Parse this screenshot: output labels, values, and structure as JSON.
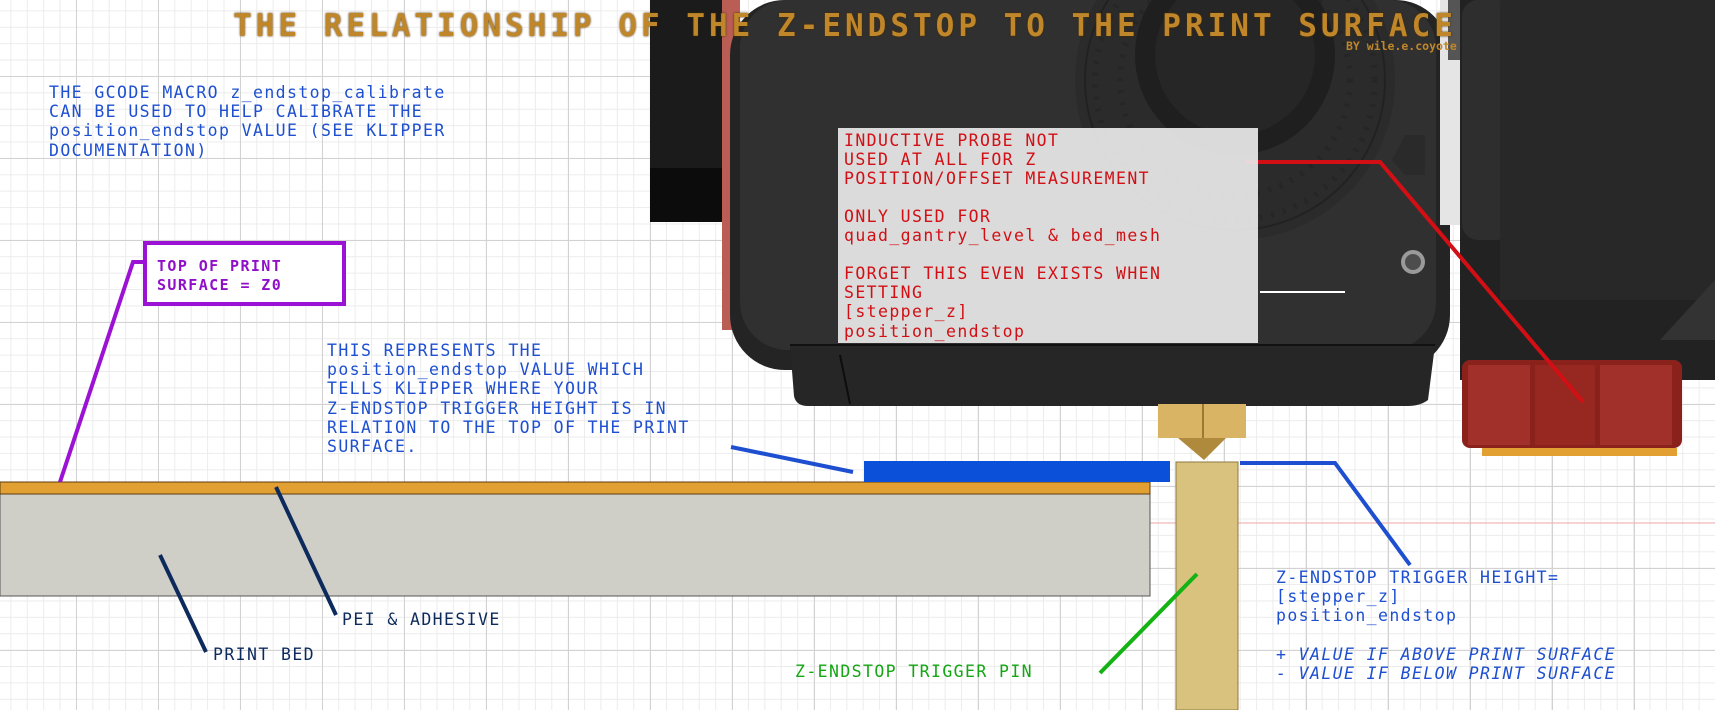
{
  "title": "THE RELATIONSHIP OF THE Z-ENDSTOP TO THE PRINT SURFACE",
  "byline": "BY wile.e.coyote",
  "colors": {
    "title_gold": "#c0862a",
    "blue_text": "#1d4fd0",
    "navy_text": "#0c2a5c",
    "green": "#14a614",
    "red": "#d20f14",
    "purple": "#9c12d4",
    "pei_orange": "#e2a032",
    "bed_grey": "#cfcfc7",
    "pin_tan": "#d8c27e",
    "trigger_band_blue": "#0a50d8"
  },
  "macro_note": {
    "lines": [
      [
        {
          "t": "THE GCODE MACRO "
        },
        {
          "t": "z_endstop_calibrate",
          "code": true
        }
      ],
      [
        {
          "t": "CAN BE USED TO HELP CALIBRATE THE"
        }
      ],
      [
        {
          "t": "position_endstop",
          "code": true
        },
        {
          "t": " VALUE (SEE KLIPPER"
        }
      ],
      [
        {
          "t": "DOCUMENTATION)"
        }
      ]
    ]
  },
  "z0_box": {
    "line1": "TOP OF PRINT",
    "line2": "SURFACE = Z0"
  },
  "probe_note": {
    "p1": "INDUCTIVE PROBE NOT\nUSED AT ALL FOR Z\nPOSITION/OFFSET MEASUREMENT",
    "p2": "ONLY USED FOR\nquad_gantry_level & bed_mesh",
    "p3": "FORGET THIS EVEN EXISTS WHEN\nSETTING\n[stepper_z]\nposition_endstop"
  },
  "position_note": {
    "line1": "THIS REPRESENTS THE",
    "line2": "position_endstop VALUE WHICH",
    "line3": "TELLS KLIPPER WHERE YOUR",
    "line4": "Z-ENDSTOP TRIGGER HEIGHT IS IN",
    "line5": "RELATION TO THE TOP OF THE PRINT",
    "line6": "SURFACE."
  },
  "labels": {
    "pei": "PEI & ADHESIVE",
    "bed": "PRINT BED",
    "pin": "Z-ENDSTOP TRIGGER PIN"
  },
  "trigger_note": {
    "line1": "Z-ENDSTOP TRIGGER HEIGHT=",
    "line2": "[stepper_z]",
    "line3": "position_endstop",
    "plus": "+ VALUE IF ABOVE PRINT SURFACE",
    "minus": "- VALUE IF BELOW PRINT SURFACE"
  }
}
